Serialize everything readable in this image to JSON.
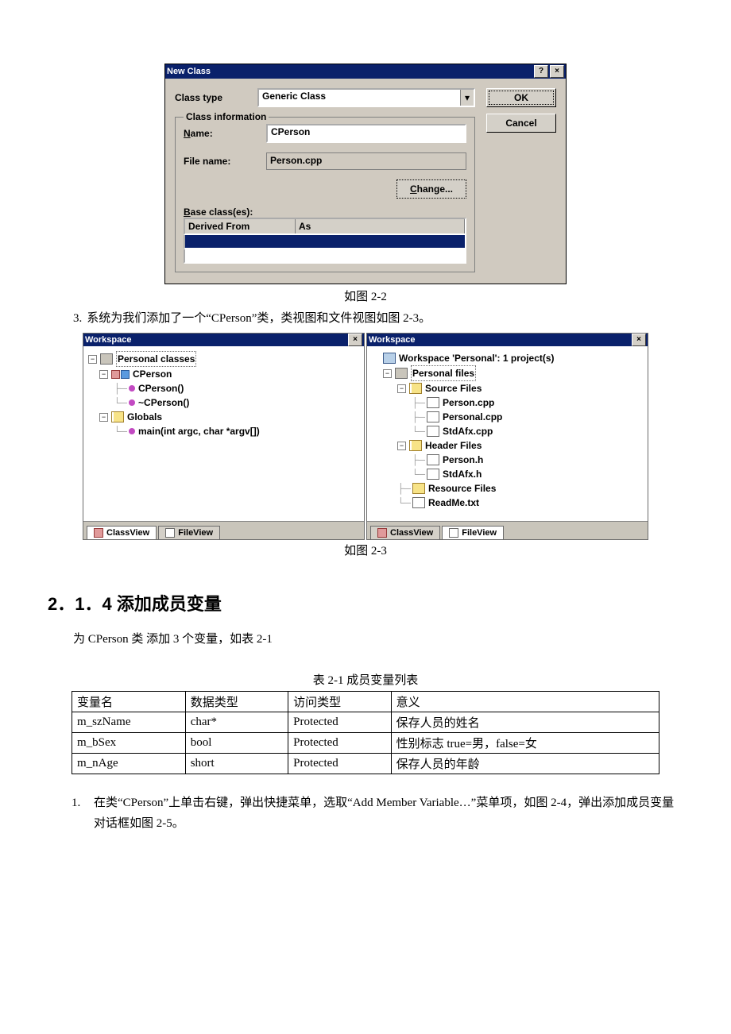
{
  "dialog": {
    "title": "New Class",
    "help_btn": "?",
    "close_btn": "×",
    "class_type_label": "Class type",
    "class_type_value": "Generic Class",
    "ok_label": "OK",
    "cancel_label": "Cancel",
    "fieldset_legend": "Class information",
    "name_label_u": "N",
    "name_label_rest": "ame:",
    "name_value": "CPerson",
    "file_label": "File name:",
    "file_value": "Person.cpp",
    "change_label_u": "C",
    "change_label_rest": "hange...",
    "base_label_u": "B",
    "base_label_rest": "ase class(es):",
    "th_derived": "Derived From",
    "th_as": "As"
  },
  "caption22": "如图 2-2",
  "para3_num": "3.",
  "para3_text": "系统为我们添加了一个“CPerson”类，类视图和文件视图如图 2-3。",
  "leftpanel": {
    "title": "Workspace",
    "close": "×",
    "root": "Personal classes",
    "cperson": "CPerson",
    "ctor": "CPerson()",
    "dtor": "~CPerson()",
    "globals": "Globals",
    "main": "main(int argc, char *argv[])",
    "tab_class": "ClassView",
    "tab_file": "FileView"
  },
  "rightpanel": {
    "title": "Workspace",
    "close": "×",
    "root": "Workspace 'Personal': 1 project(s)",
    "proj": "Personal files",
    "src": "Source Files",
    "f1": "Person.cpp",
    "f2": "Personal.cpp",
    "f3": "StdAfx.cpp",
    "hdr": "Header Files",
    "h1": "Person.h",
    "h2": "StdAfx.h",
    "res": "Resource Files",
    "rm": "ReadMe.txt",
    "tab_class": "ClassView",
    "tab_file": "FileView"
  },
  "caption23": "如图 2-3",
  "section_title": "2．1．4 添加成员变量",
  "section_intro": "为 CPerson 类 添加 3 个变量，如表 2-1",
  "table_caption": "表 2-1 成员变量列表",
  "table": {
    "head": [
      "变量名",
      "数据类型",
      "访问类型",
      "意义"
    ],
    "rows": [
      [
        "m_szName",
        "char*",
        "Protected",
        "保存人员的姓名"
      ],
      [
        "m_bSex",
        "bool",
        "Protected",
        "性别标志 true=男，false=女"
      ],
      [
        "m_nAge",
        "short",
        "Protected",
        "保存人员的年龄"
      ]
    ]
  },
  "step1_num": "1.",
  "step1_text": "在类“CPerson”上单击右键，弹出快捷菜单，选取“Add Member Variable…”菜单项，如图 2-4，弹出添加成员变量对话框如图 2-5。"
}
